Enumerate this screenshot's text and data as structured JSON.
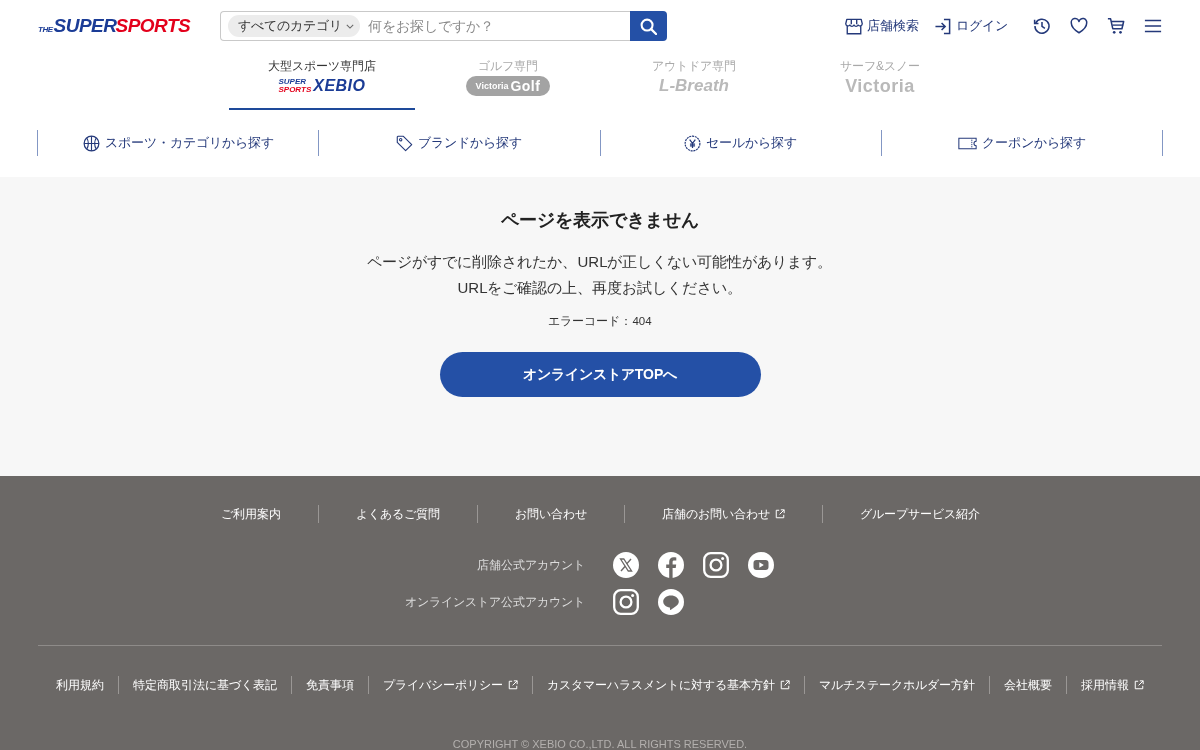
{
  "header": {
    "logo": {
      "small": "THE",
      "first": "SUPER",
      "second": "SPORTS"
    },
    "search": {
      "category": "すべてのカテゴリ",
      "placeholder": "何をお探しですか？"
    },
    "actions": [
      {
        "label": "店舗検索"
      },
      {
        "label": "ログイン"
      }
    ]
  },
  "store_tabs": [
    {
      "caption": "大型スポーツ専門店",
      "kind": "stacked",
      "logo": [
        "SUPER",
        "SPORTS",
        "XEBIO"
      ],
      "selected": true
    },
    {
      "caption": "ゴルフ専門",
      "kind": "pill",
      "logo": [
        "Victoria",
        "Golf"
      ],
      "selected": false
    },
    {
      "caption": "アウトドア専門",
      "kind": "italic",
      "logo": [
        "L-Breath"
      ],
      "selected": false
    },
    {
      "caption": "サーフ&スノー",
      "kind": "plain",
      "logo": [
        "Victoria"
      ],
      "selected": false
    }
  ],
  "nav": [
    {
      "label": "スポーツ・カテゴリから探す"
    },
    {
      "label": "ブランドから探す"
    },
    {
      "label": "セールから探す"
    },
    {
      "label": "クーポンから探す"
    }
  ],
  "error": {
    "title": "ページを表示できません",
    "message": [
      "ページがすでに削除されたか、URLが正しくない可能性があります。",
      "URLをご確認の上、再度お試しください。"
    ],
    "code": "エラーコード：404",
    "button": "オンラインストアTOPへ"
  },
  "footer": {
    "links": [
      {
        "label": "ご利用案内",
        "external": false
      },
      {
        "label": "よくあるご質問",
        "external": false
      },
      {
        "label": "お問い合わせ",
        "external": false
      },
      {
        "label": "店舗のお問い合わせ",
        "external": true
      },
      {
        "label": "グループサービス紹介",
        "external": false
      }
    ],
    "accounts": [
      {
        "label": "店舗公式アカウント"
      },
      {
        "label": "オンラインストア公式アカウント"
      }
    ],
    "legal_links": [
      {
        "label": "利用規約",
        "external": false
      },
      {
        "label": "特定商取引法に基づく表記",
        "external": false
      },
      {
        "label": "免責事項",
        "external": false
      },
      {
        "label": "プライバシーポリシー",
        "external": true
      },
      {
        "label": "カスタマーハラスメントに対する基本方針",
        "external": true
      },
      {
        "label": "マルチステークホルダー方針",
        "external": false
      },
      {
        "label": "会社概要",
        "external": false
      },
      {
        "label": "採用情報",
        "external": true
      }
    ],
    "copyright": "COPYRIGHT © XEBIO CO.,LTD. ALL RIGHTS RESERVED."
  }
}
